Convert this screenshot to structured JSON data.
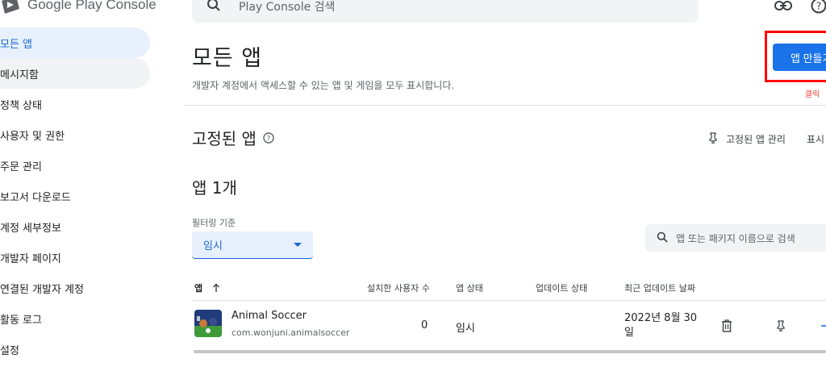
{
  "app": {
    "title": "Google Play Console"
  },
  "sidebar": {
    "items": [
      {
        "label": "모든 앱"
      },
      {
        "label": "메시지함"
      },
      {
        "label": "정책 상태"
      },
      {
        "label": "사용자 및 권한"
      },
      {
        "label": "주문 관리"
      },
      {
        "label": "보고서 다운로드"
      },
      {
        "label": "계정 세부정보"
      },
      {
        "label": "개발자 페이지"
      },
      {
        "label": "연결된 개발자 계정"
      },
      {
        "label": "활동 로그"
      },
      {
        "label": "설정"
      }
    ]
  },
  "header": {
    "search_placeholder": "Play Console 검색",
    "icons": [
      "search-icon",
      "link-icon",
      "help-icon"
    ]
  },
  "main": {
    "title": "모든 앱",
    "subtitle": "개발자 계정에서 액세스할 수 있는 앱 및 게임을 모두 표시합니다.",
    "create_button": "앱 만들기",
    "click_annotation": "클릭",
    "pinned_title": "고정된 앱",
    "pin_manage": "고정된 앱 관리",
    "show_label": "표시",
    "apps_count": "앱 1개",
    "filter": {
      "label": "필터링 기준",
      "selected": "임시"
    },
    "app_search_placeholder": "앱 또는 패키지 이름으로 검색"
  },
  "table": {
    "headers": {
      "app": "앱",
      "installs": "설치한 사용자 수",
      "status": "앱 상태",
      "update_status": "업데이트 상태",
      "last_updated": "최근 업데이트 날짜"
    },
    "rows": [
      {
        "name": "Animal Soccer",
        "package": "com.wonjuni.animalsoccer",
        "installs": "0",
        "status": "임시",
        "update_status": "",
        "last_updated": "2022년 8월 30일"
      }
    ]
  },
  "colors": {
    "accent": "#1a73e8",
    "active_nav_bg": "#e8f0fe",
    "highlight_border": "#ff0000"
  }
}
